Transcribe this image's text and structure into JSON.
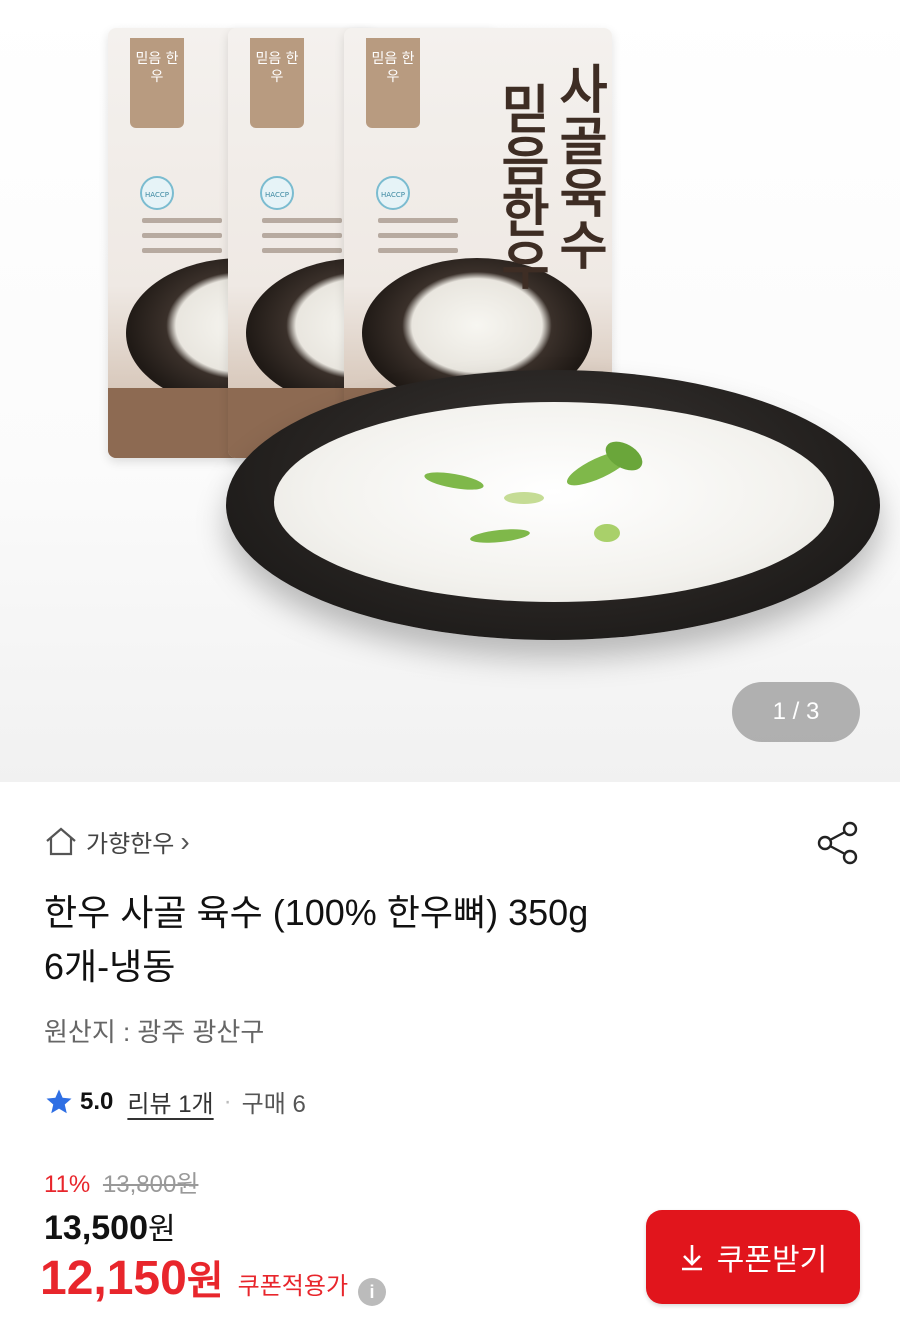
{
  "gallery": {
    "counter": "1 / 3",
    "package_brand": "믿음\n한우",
    "package_title_1": "믿음한우",
    "package_title_2": "사골육수",
    "package_badge": "HACCP"
  },
  "store": {
    "name": "가향한우",
    "chevron": "›"
  },
  "product": {
    "title_line1": "한우 사골 육수 (100% 한우뼈) 350g",
    "title_line2": "6개-냉동",
    "origin": "원산지 : 광주 광산구"
  },
  "rating": {
    "score": "5.0",
    "reviews": "리뷰 1개",
    "separator": "·",
    "purchases": "구매 6"
  },
  "pricing": {
    "discount_pct": "11%",
    "original_price": "13,800원",
    "price": "13,500",
    "price_unit": "원",
    "coupon_price": "12,150",
    "coupon_unit": "원",
    "coupon_label": "쿠폰적용가",
    "info_glyph": "i"
  },
  "coupon_button": {
    "label": "쿠폰받기"
  },
  "colors": {
    "accent_red": "#e1151c",
    "price_red": "#e8262c",
    "star_blue": "#2f6fe4"
  },
  "icons": [
    "home-icon",
    "chevron-right-icon",
    "share-icon",
    "star-icon",
    "info-icon",
    "download-icon"
  ]
}
